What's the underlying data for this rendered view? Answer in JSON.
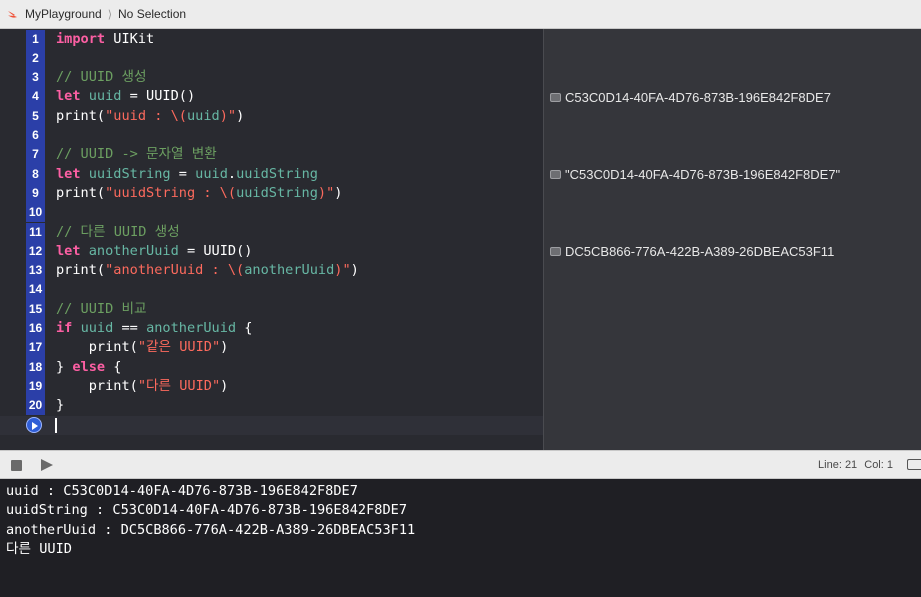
{
  "breadcrumb": {
    "project": "MyPlayground",
    "separator": "⟩",
    "selection": "No Selection"
  },
  "editor": {
    "lines": [
      {
        "n": "1",
        "tokens": [
          {
            "t": "import",
            "c": "kw"
          },
          {
            "t": " UIKit",
            "c": ""
          }
        ]
      },
      {
        "n": "2",
        "tokens": []
      },
      {
        "n": "3",
        "tokens": [
          {
            "t": "// UUID 생성",
            "c": "com"
          }
        ]
      },
      {
        "n": "4",
        "tokens": [
          {
            "t": "let",
            "c": "kw"
          },
          {
            "t": " ",
            "c": ""
          },
          {
            "t": "uuid",
            "c": "var"
          },
          {
            "t": " = UUID()",
            "c": ""
          }
        ]
      },
      {
        "n": "5",
        "tokens": [
          {
            "t": "print(",
            "c": ""
          },
          {
            "t": "\"uuid : \\(",
            "c": "str"
          },
          {
            "t": "uuid",
            "c": "var"
          },
          {
            "t": ")\"",
            "c": "str"
          },
          {
            "t": ")",
            "c": ""
          }
        ]
      },
      {
        "n": "6",
        "tokens": []
      },
      {
        "n": "7",
        "tokens": [
          {
            "t": "// UUID -> 문자열 변환",
            "c": "com"
          }
        ]
      },
      {
        "n": "8",
        "tokens": [
          {
            "t": "let",
            "c": "kw"
          },
          {
            "t": " ",
            "c": ""
          },
          {
            "t": "uuidString",
            "c": "var"
          },
          {
            "t": " = ",
            "c": ""
          },
          {
            "t": "uuid",
            "c": "var"
          },
          {
            "t": ".",
            "c": ""
          },
          {
            "t": "uuidString",
            "c": "var"
          }
        ]
      },
      {
        "n": "9",
        "tokens": [
          {
            "t": "print(",
            "c": ""
          },
          {
            "t": "\"uuidString : \\(",
            "c": "str"
          },
          {
            "t": "uuidString",
            "c": "var"
          },
          {
            "t": ")\"",
            "c": "str"
          },
          {
            "t": ")",
            "c": ""
          }
        ]
      },
      {
        "n": "10",
        "tokens": []
      },
      {
        "n": "11",
        "tokens": [
          {
            "t": "// 다른 UUID 생성",
            "c": "com"
          }
        ]
      },
      {
        "n": "12",
        "tokens": [
          {
            "t": "let",
            "c": "kw"
          },
          {
            "t": " ",
            "c": ""
          },
          {
            "t": "anotherUuid",
            "c": "var"
          },
          {
            "t": " = UUID()",
            "c": ""
          }
        ]
      },
      {
        "n": "13",
        "tokens": [
          {
            "t": "print(",
            "c": ""
          },
          {
            "t": "\"anotherUuid : \\(",
            "c": "str"
          },
          {
            "t": "anotherUuid",
            "c": "var"
          },
          {
            "t": ")\"",
            "c": "str"
          },
          {
            "t": ")",
            "c": ""
          }
        ]
      },
      {
        "n": "14",
        "tokens": []
      },
      {
        "n": "15",
        "tokens": [
          {
            "t": "// UUID 비교",
            "c": "com"
          }
        ]
      },
      {
        "n": "16",
        "tokens": [
          {
            "t": "if",
            "c": "kw"
          },
          {
            "t": " ",
            "c": ""
          },
          {
            "t": "uuid",
            "c": "var"
          },
          {
            "t": " == ",
            "c": ""
          },
          {
            "t": "anotherUuid",
            "c": "var"
          },
          {
            "t": " {",
            "c": ""
          }
        ]
      },
      {
        "n": "17",
        "tokens": [
          {
            "t": "    print(",
            "c": ""
          },
          {
            "t": "\"같은 UUID\"",
            "c": "str"
          },
          {
            "t": ")",
            "c": ""
          }
        ]
      },
      {
        "n": "18",
        "tokens": [
          {
            "t": "} ",
            "c": ""
          },
          {
            "t": "else",
            "c": "kw"
          },
          {
            "t": " {",
            "c": ""
          }
        ]
      },
      {
        "n": "19",
        "tokens": [
          {
            "t": "    print(",
            "c": ""
          },
          {
            "t": "\"다른 UUID\"",
            "c": "str"
          },
          {
            "t": ")",
            "c": ""
          }
        ]
      },
      {
        "n": "20",
        "tokens": [
          {
            "t": "}",
            "c": ""
          }
        ]
      }
    ]
  },
  "results": [
    {
      "line": 4,
      "text": "C53C0D14-40FA-4D76-873B-196E842F8DE7"
    },
    {
      "line": 8,
      "text": "\"C53C0D14-40FA-4D76-873B-196E842F8DE7\""
    },
    {
      "line": 12,
      "text": "DC5CB866-776A-422B-A389-26DBEAC53F11"
    }
  ],
  "toolbar": {
    "line_label": "Line: 21",
    "col_label": "Col: 1"
  },
  "console": {
    "lines": [
      "uuid : C53C0D14-40FA-4D76-873B-196E842F8DE7",
      "uuidString : C53C0D14-40FA-4D76-873B-196E842F8DE7",
      "anotherUuid : DC5CB866-776A-422B-A389-26DBEAC53F11",
      "다른 UUID"
    ]
  },
  "icons": {
    "swift": "swift-logo-icon",
    "run": "run-line-icon",
    "stop": "stop-icon",
    "play": "play-icon",
    "result": "quick-look-icon",
    "panel": "toggle-panel-icon"
  }
}
